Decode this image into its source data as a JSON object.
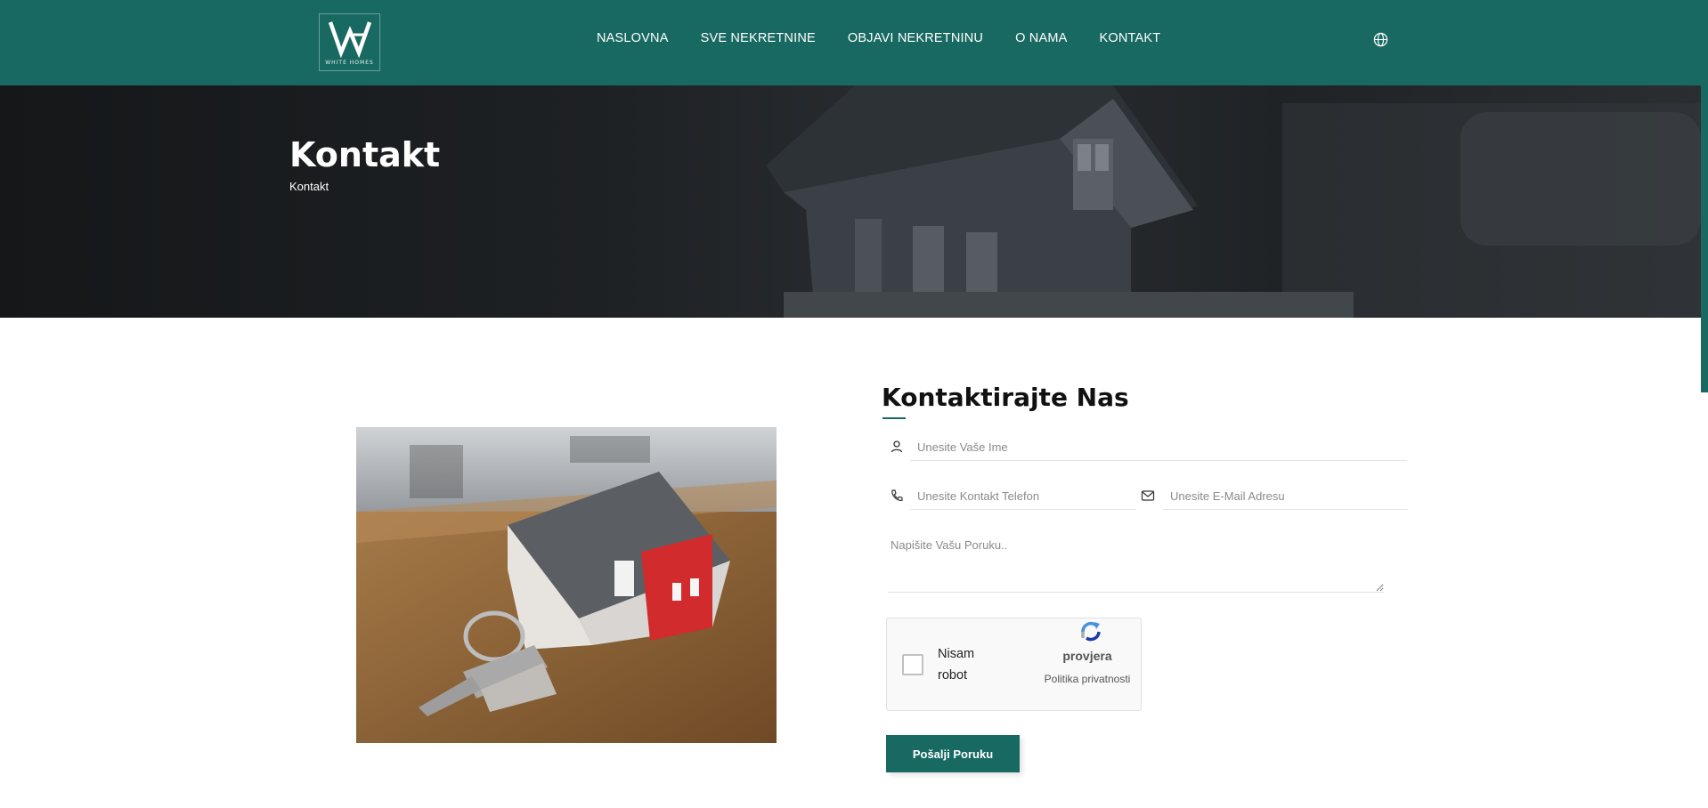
{
  "header": {
    "logo_text": "WHITE HOMES",
    "nav": [
      {
        "label": "NASLOVNA"
      },
      {
        "label": "SVE NEKRETNINE"
      },
      {
        "label": "OBJAVI NEKRETNINU"
      },
      {
        "label": "O NAMA"
      },
      {
        "label": "KONTAKT"
      }
    ],
    "globe_icon": "globe-icon"
  },
  "hero": {
    "title": "Kontakt",
    "breadcrumb": "Kontakt"
  },
  "form": {
    "title": "Kontaktirajte Nas",
    "name_placeholder": "Unesite Vaše Ime",
    "phone_placeholder": "Unesite Kontakt Telefon",
    "email_placeholder": "Unesite E-Mail Adresu",
    "message_placeholder": "Napišite Vašu Poruku..",
    "submit_label": "Pošalji Poruku"
  },
  "captcha": {
    "checkbox_label": "Nisam robot",
    "brand": "provjera",
    "privacy": "Politika privatnosti"
  },
  "colors": {
    "brand": "#186962",
    "hero_dark": "#1e2124"
  }
}
